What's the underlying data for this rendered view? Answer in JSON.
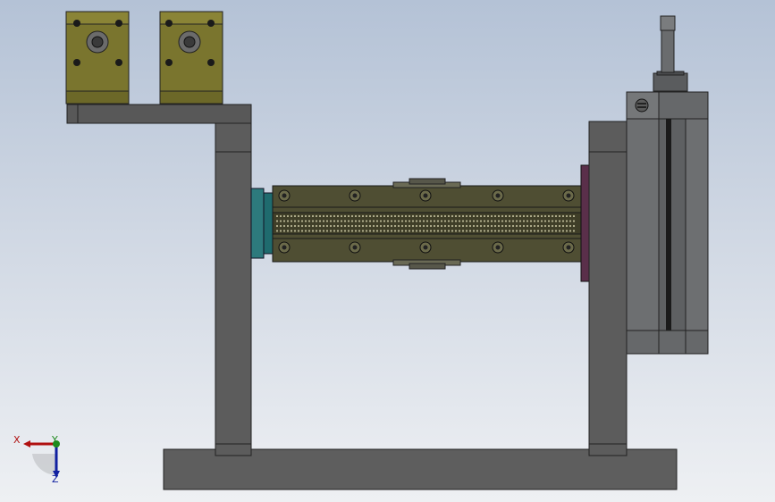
{
  "triad": {
    "x_label": "X",
    "y_label": "Y",
    "z_label": "Z",
    "x_color": "#b01010",
    "y_color": "#1e8a1e",
    "z_color": "#1020a0"
  },
  "colors": {
    "frame_steel": "#5e5e5e",
    "frame_edge": "#2a2a2a",
    "rail_olive": "#4f4e33",
    "block_olive": "#7a752e",
    "coupling_teal": "#1f6b6e",
    "flange_purple": "#5a2f4a",
    "motor_gray": "#6d6f71"
  }
}
